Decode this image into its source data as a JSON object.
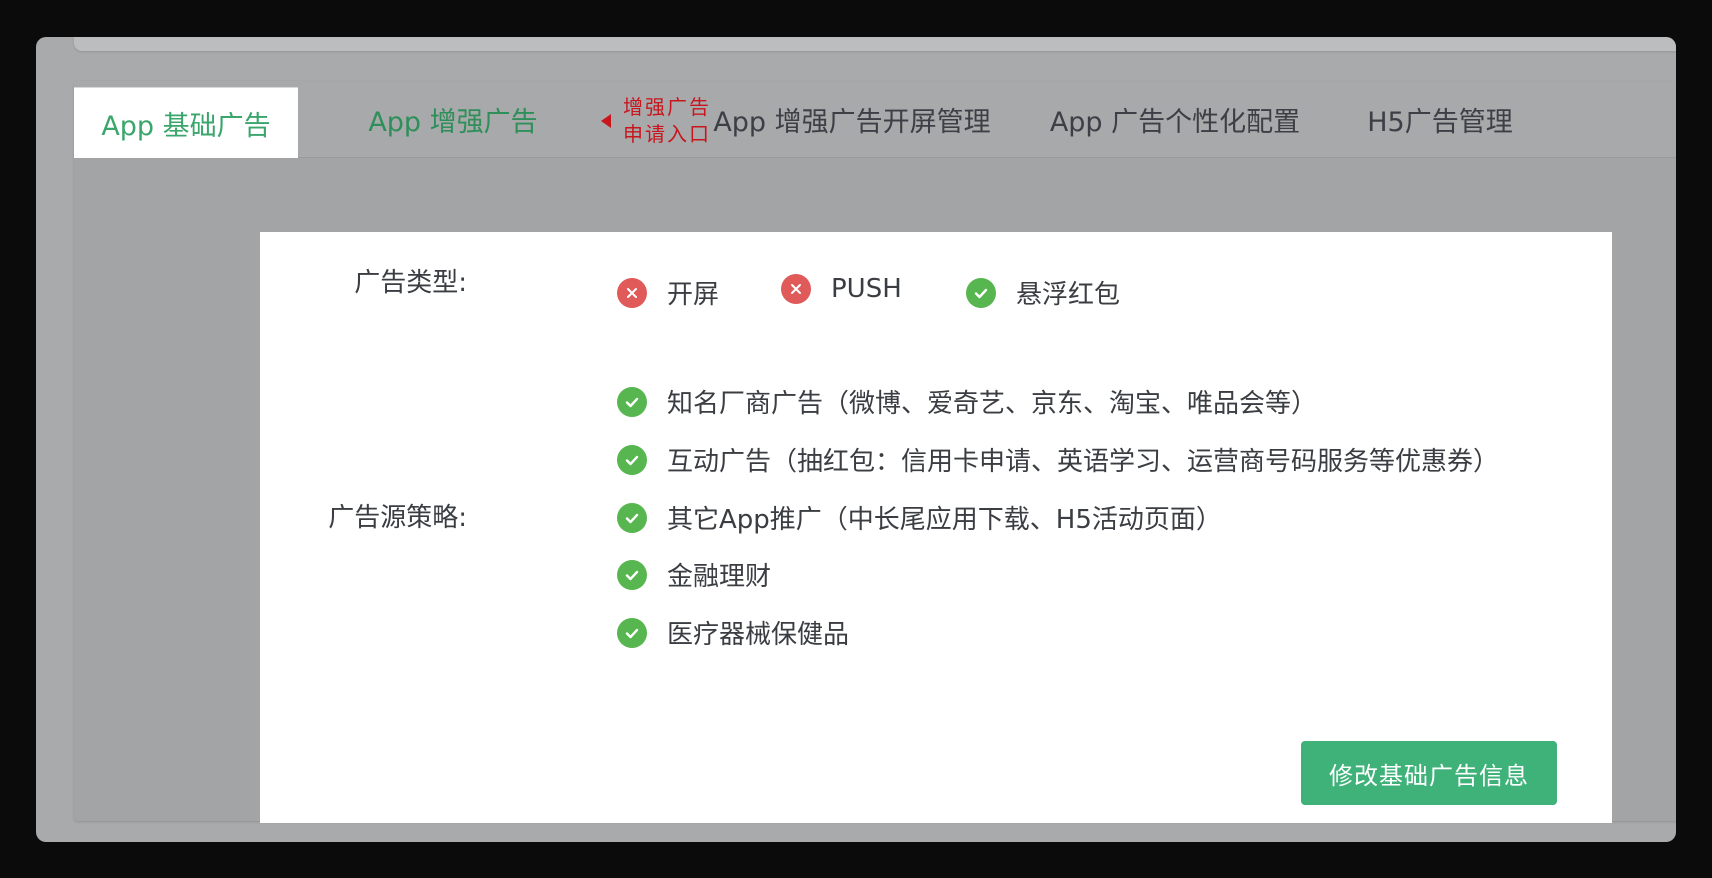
{
  "tabs": [
    {
      "label": "App 基础广告"
    },
    {
      "label": "App 增强广告"
    },
    {
      "label": "App 增强广告开屏管理"
    },
    {
      "label": "App 广告个性化配置"
    },
    {
      "label": "H5广告管理"
    }
  ],
  "annotation": {
    "line1": "增强广告",
    "line2": "申请入口",
    "color": "#c9151e"
  },
  "ad_types": {
    "label": "广告类型:",
    "options": [
      {
        "text": "开屏",
        "enabled": false,
        "icon": "x-circle-icon"
      },
      {
        "text": "PUSH",
        "enabled": false,
        "icon": "x-circle-icon"
      },
      {
        "text": "悬浮红包",
        "enabled": true,
        "icon": "check-circle-icon"
      }
    ]
  },
  "ad_sources": {
    "label": "广告源策略:",
    "items": [
      {
        "text": "知名厂商广告（微博、爱奇艺、京东、淘宝、唯品会等）",
        "enabled": true,
        "icon": "check-circle-icon"
      },
      {
        "text": "互动广告（抽红包：信用卡申请、英语学习、运营商号码服务等优惠券）",
        "enabled": true,
        "icon": "check-circle-icon"
      },
      {
        "text": "其它App推广（中长尾应用下载、H5活动页面）",
        "enabled": true,
        "icon": "check-circle-icon"
      },
      {
        "text": "金融理财",
        "enabled": true,
        "icon": "check-circle-icon"
      },
      {
        "text": "医疗器械保健品",
        "enabled": true,
        "icon": "check-circle-icon"
      }
    ]
  },
  "actions": {
    "edit_label": "修改基础广告信息"
  },
  "colors": {
    "accent_green": "#3fb27a",
    "check_green": "#57b64f",
    "cross_red": "#e05a5a"
  }
}
